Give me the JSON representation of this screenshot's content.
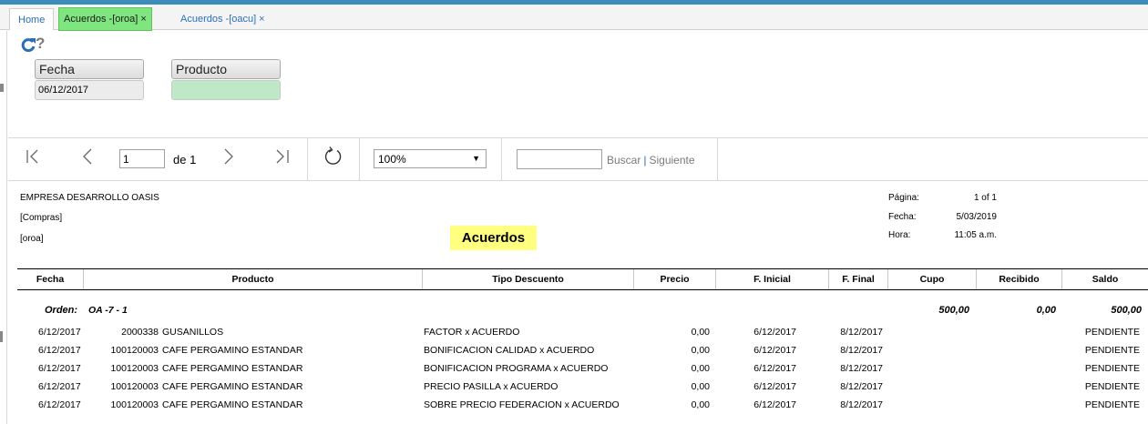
{
  "tabs": [
    {
      "label": "Home"
    },
    {
      "label": "Acuerdos -[oroa]",
      "close": "×"
    },
    {
      "label": "Acuerdos -[oacu]",
      "close": "×"
    }
  ],
  "params": {
    "help": "?",
    "fecha_label": "Fecha",
    "fecha_value": "06/12/2017",
    "producto_label": "Producto",
    "producto_value": ""
  },
  "toolbar": {
    "page_value": "1",
    "of_label": "de 1",
    "zoom_value": "100%",
    "zoom_arrow": "▼",
    "search_value": "",
    "find_label": "Buscar",
    "separator": "|",
    "next_label": "Siguiente"
  },
  "report": {
    "company": "EMPRESA DESARROLLO OASIS",
    "section": "[Compras]",
    "code": "[oroa]",
    "title": "Acuerdos",
    "page_label": "Página:",
    "page_value": "1 of 1",
    "date_label": "Fecha:",
    "date_value": "5/03/2019",
    "time_label": "Hora:",
    "time_value": "11:05 a.m.",
    "columns": [
      "Fecha",
      "Producto",
      "Tipo Descuento",
      "Precio",
      "F. Inicial",
      "F. Final",
      "Cupo",
      "Recibido",
      "Saldo"
    ],
    "group": {
      "label": "Orden:",
      "value": "OA -7 - 1",
      "cupo": "500,00",
      "recibido": "0,00",
      "saldo": "500,00"
    },
    "rows": [
      {
        "fecha": "6/12/2017",
        "codigo": "2000338",
        "producto": "GUSANILLOS",
        "tipo": "FACTOR x ACUERDO",
        "precio": "0,00",
        "inicial": "6/12/2017",
        "final": "8/12/2017",
        "estado": "PENDIENTE"
      },
      {
        "fecha": "6/12/2017",
        "codigo": "100120003",
        "producto": "CAFE PERGAMINO ESTANDAR",
        "tipo": "BONIFICACION CALIDAD x ACUERDO",
        "precio": "0,00",
        "inicial": "6/12/2017",
        "final": "8/12/2017",
        "estado": "PENDIENTE"
      },
      {
        "fecha": "6/12/2017",
        "codigo": "100120003",
        "producto": "CAFE PERGAMINO ESTANDAR",
        "tipo": "BONIFICACION PROGRAMA x ACUERDO",
        "precio": "0,00",
        "inicial": "6/12/2017",
        "final": "8/12/2017",
        "estado": "PENDIENTE"
      },
      {
        "fecha": "6/12/2017",
        "codigo": "100120003",
        "producto": "CAFE PERGAMINO ESTANDAR",
        "tipo": "PRECIO PASILLA x ACUERDO",
        "precio": "0,00",
        "inicial": "6/12/2017",
        "final": "8/12/2017",
        "estado": "PENDIENTE"
      },
      {
        "fecha": "6/12/2017",
        "codigo": "100120003",
        "producto": "CAFE PERGAMINO ESTANDAR",
        "tipo": "SOBRE PRECIO FEDERACION x ACUERDO",
        "precio": "0,00",
        "inicial": "6/12/2017",
        "final": "8/12/2017",
        "estado": "PENDIENTE"
      }
    ]
  },
  "colors": {
    "topbar": "#3c8dbc",
    "active_tab": "#7fe57f",
    "title_highlight": "#ffff80",
    "link": "#2a6ebb"
  }
}
